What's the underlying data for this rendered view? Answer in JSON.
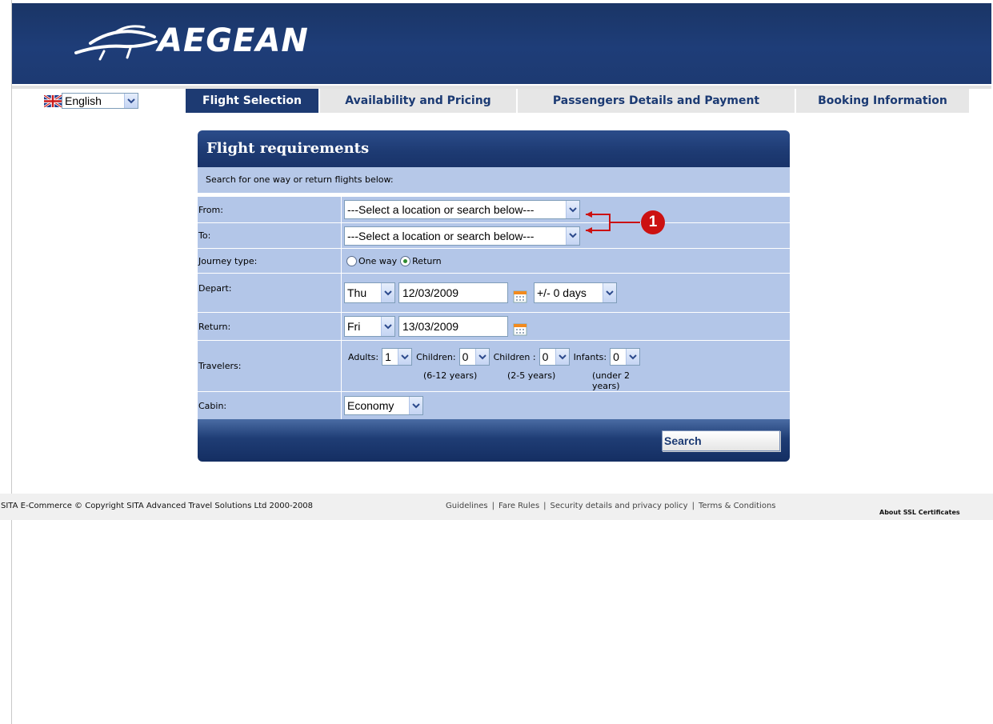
{
  "brand": {
    "name": "AEGEAN"
  },
  "language": {
    "selected": "English"
  },
  "tabs": [
    {
      "label": "Flight Selection",
      "active": true
    },
    {
      "label": "Availability and Pricing",
      "active": false
    },
    {
      "label": "Passengers Details and Payment",
      "active": false
    },
    {
      "label": "Booking Information",
      "active": false
    }
  ],
  "panel": {
    "title": "Flight requirements",
    "subtitle": "Search for one way or return flights below:",
    "from": {
      "label": "From:",
      "value": "---Select a location or search below---"
    },
    "to": {
      "label": "To:",
      "value": "---Select a location or search below---"
    },
    "journey": {
      "label": "Journey type:",
      "one_way": "One way",
      "return": "Return",
      "selected": "Return"
    },
    "depart": {
      "label": "Depart:",
      "day": "Thu",
      "date": "12/03/2009",
      "flex": "+/- 0 days"
    },
    "return_date": {
      "label": "Return:",
      "day": "Fri",
      "date": "13/03/2009"
    },
    "travelers": {
      "label": "Travelers:",
      "adults_label": "Adults:",
      "adults": "1",
      "children_label": "Children:",
      "children": "0",
      "children_note": "(6-12 years)",
      "children2_label": "Children :",
      "children2": "0",
      "children2_note": "(2-5 years)",
      "infants_label": "Infants:",
      "infants": "0",
      "infants_note": "(under 2 years)"
    },
    "cabin": {
      "label": "Cabin:",
      "value": "Economy"
    },
    "search_label": "Search"
  },
  "callout": {
    "number": "1"
  },
  "footer": {
    "copyright": "SITA E-Commerce © Copyright SITA Advanced Travel Solutions Ltd 2000-2008",
    "links": [
      "Guidelines",
      "Fare Rules",
      "Security details and privacy policy",
      "Terms & Conditions"
    ],
    "ssl": "About SSL Certificates"
  },
  "colors": {
    "brand_navy": "#1d3a72",
    "form_bg": "#b3c6e8",
    "callout_red": "#cc1111"
  }
}
